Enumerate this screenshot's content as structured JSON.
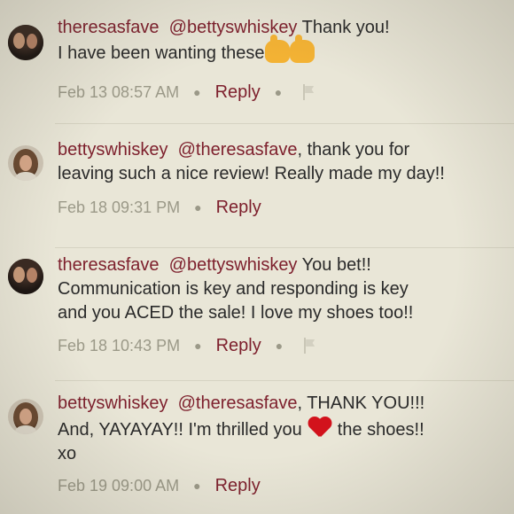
{
  "comments": [
    {
      "username": "theresasfave",
      "mention": "@bettyswhiskey",
      "text_after_mention": " Thank you!",
      "line2": "I have  been wanting these",
      "emoji": "thumbs-up-icon",
      "time": "Feb 13 08:57 AM",
      "reply": "Reply",
      "has_flag": true
    },
    {
      "username": "bettyswhiskey",
      "mention": "@theresasfave",
      "text_after_mention": ", thank you for",
      "line2": "leaving such a nice review! Really made my day!!",
      "time": "Feb 18 09:31 PM",
      "reply": "Reply",
      "has_flag": false
    },
    {
      "username": "theresasfave",
      "mention": "@bettyswhiskey",
      "text_after_mention": "  You bet!!",
      "line2": "Communication  is key and responding is key",
      "line3": "and you ACED the sale! I love my shoes too!!",
      "time": "Feb 18 10:43 PM",
      "reply": "Reply",
      "has_flag": true
    },
    {
      "username": "bettyswhiskey",
      "mention": "@theresasfave",
      "text_after_mention": ", THANK YOU!!!",
      "line2_before_heart": "And, YAYAYAY!! I'm thrilled you",
      "line2_after_heart": "the shoes!!",
      "line3": "xo",
      "emoji": "heart-icon",
      "time": "Feb 19 09:00 AM",
      "reply": "Reply",
      "has_flag": false
    }
  ],
  "colors": {
    "background": "#e9e6d7",
    "username": "#7d1f2c",
    "text": "#2a2a2a",
    "meta": "#9b9988"
  }
}
